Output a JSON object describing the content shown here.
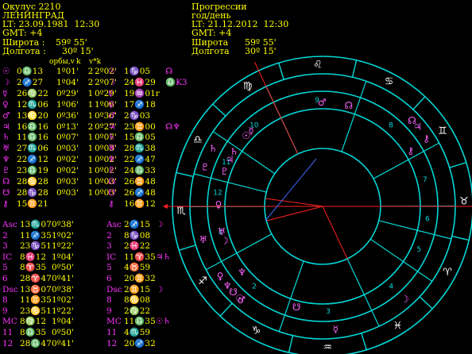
{
  "natal": {
    "title": "Окулус 2210",
    "name": "ЛЕНИНГРАД",
    "lt": "LT: 23.09.1981  12:30",
    "gmt": "GMT: +4",
    "lat_label": "Широта :",
    "lat_value": "59º 55'",
    "lon_label": "Долгота :",
    "lon_value": "30º 15'"
  },
  "progress": {
    "title": "Прогрессии",
    "subtitle": "год/день",
    "lt": "LT: 21.12.2012  12:30",
    "gmt": "GMT: +4",
    "lat_label": "Широта",
    "lat_value": "59º 55'",
    "lon_label": "Долгота",
    "lon_value": "30º 15'"
  },
  "columns": {
    "orbs": "орбы,v",
    "k": "k",
    "vk": "v*k"
  },
  "colors": {
    "yellow": "#ffff00",
    "magenta": "#ff33ff",
    "cyan": "#00d8d8",
    "red": "#ff2020",
    "blue": "#3f6bff"
  },
  "planets_natal": [
    {
      "sym": "☉",
      "pos": "0♎13",
      "orb": "1º01'",
      "k": "2",
      "vk": "2º02'"
    },
    {
      "sym": "☽",
      "pos": "2♐27",
      "orb": "1º04'",
      "k": "2",
      "vk": "2º07'"
    },
    {
      "sym": "☿",
      "pos": "26♍22",
      "orb": "0º29'",
      "k": "1",
      "vk": "0º29'"
    },
    {
      "sym": "♀",
      "pos": "12♏06",
      "orb": "1º06'",
      "k": "1",
      "vk": "1º06'"
    },
    {
      "sym": "♂",
      "pos": "13♌20",
      "orb": "0º36'",
      "k": "1",
      "vk": "0º36'"
    },
    {
      "sym": "♃",
      "pos": "16♎16",
      "orb": "0º13'",
      "k": "2",
      "vk": "0º27'"
    },
    {
      "sym": "♄",
      "pos": "11♎16",
      "orb": "0º07'",
      "k": "1",
      "vk": "0º07'"
    },
    {
      "sym": "♅",
      "pos": "27♏06",
      "orb": "0º03'",
      "k": "1",
      "vk": "0º03'"
    },
    {
      "sym": "♆",
      "pos": "22♐12",
      "orb": "0º02'",
      "k": "1",
      "vk": "0º02'"
    },
    {
      "sym": "♇",
      "pos": "23♎19",
      "orb": "0º02'",
      "k": "1",
      "vk": "0º02'"
    },
    {
      "sym": "☊",
      "pos": "28♋28",
      "orb": "0º03'",
      "k": "1",
      "vk": "0º03'"
    },
    {
      "sym": "☋",
      "pos": "28♑28",
      "orb": "0º03'",
      "k": "1",
      "vk": "0º03'"
    },
    {
      "sym": "⚷",
      "pos": "15♊21",
      "orb": "",
      "k": "",
      "vk": ""
    }
  ],
  "planets_prog": [
    {
      "sym": "☉",
      "pos": "1♑05",
      "aspect": "☊"
    },
    {
      "sym": "☽",
      "pos": "24♓29",
      "aspect": "♎K3"
    },
    {
      "sym": "☿",
      "pos": "19♒01r",
      "aspect": ""
    },
    {
      "sym": "♀",
      "pos": "17♐18",
      "aspect": ""
    },
    {
      "sym": "♂",
      "pos": "2♑03",
      "aspect": ""
    },
    {
      "sym": "♃",
      "pos": "23♊00",
      "aspect": "☊♆"
    },
    {
      "sym": "♄",
      "pos": "15♎05",
      "aspect": ""
    },
    {
      "sym": "♅",
      "pos": "28♏38",
      "aspect": ""
    },
    {
      "sym": "♆",
      "pos": "22♐47",
      "aspect": ""
    },
    {
      "sym": "♇",
      "pos": "24♎33",
      "aspect": ""
    },
    {
      "sym": "☊",
      "pos": "26♊48",
      "aspect": ""
    },
    {
      "sym": "☋",
      "pos": "26♐48",
      "aspect": ""
    },
    {
      "sym": "⚷",
      "pos": "16♊12",
      "aspect": ""
    }
  ],
  "houses_natal": [
    {
      "label": "Asc",
      "pos": "13♏07",
      "orb": "0º38'"
    },
    {
      "label": "2",
      "pos": "11♐35",
      "orb": "1º02'"
    },
    {
      "label": "3",
      "pos": "23♑51",
      "orb": "1º22'"
    },
    {
      "label": "IC",
      "pos": "8♓12",
      "orb": "1º04'"
    },
    {
      "label": "5",
      "pos": "8♈35",
      "orb": "0º50'"
    },
    {
      "label": "6",
      "pos": "28♈47",
      "orb": "0º41'"
    },
    {
      "label": "Dsc",
      "pos": "13♉07",
      "orb": "0º38'"
    },
    {
      "label": "8",
      "pos": "11♊35",
      "orb": "1º02'"
    },
    {
      "label": "9",
      "pos": "23♋51",
      "orb": "1º22'"
    },
    {
      "label": "MC",
      "pos": "8♍12",
      "orb": "1º04'"
    },
    {
      "label": "11",
      "pos": "8♎35",
      "orb": "0º50'"
    },
    {
      "label": "12",
      "pos": "28♎47",
      "orb": "0º41'"
    }
  ],
  "houses_prog": [
    {
      "label": "Asc",
      "pos": "2♐15",
      "aspect": "☽"
    },
    {
      "label": "2",
      "pos": "8♑08",
      "aspect": ""
    },
    {
      "label": "3",
      "pos": "2♓22",
      "aspect": ""
    },
    {
      "label": "IC",
      "pos": "11♈35",
      "aspect": "♃♄"
    },
    {
      "label": "5",
      "pos": "4♉59",
      "aspect": ""
    },
    {
      "label": "6",
      "pos": "20♊32",
      "aspect": ""
    },
    {
      "label": "Dsc",
      "pos": "2♊15",
      "aspect": "☽"
    },
    {
      "label": "8",
      "pos": "8♋08",
      "aspect": ""
    },
    {
      "label": "9",
      "pos": "2♍22",
      "aspect": ""
    },
    {
      "label": "MC",
      "pos": "11♎35",
      "aspect": "☉♄"
    },
    {
      "label": "11",
      "pos": "4♏59",
      "aspect": ""
    },
    {
      "label": "12",
      "pos": "20♐32",
      "aspect": ""
    }
  ],
  "wheel": {
    "signs": [
      "♈",
      "♉",
      "♊",
      "♋",
      "♌",
      "♍",
      "♎",
      "♏",
      "♐",
      "♑",
      "♒",
      "♓"
    ],
    "house_numbers": [
      "1",
      "2",
      "3",
      "4",
      "5",
      "6",
      "7",
      "8",
      "9",
      "10",
      "11",
      "12"
    ]
  }
}
